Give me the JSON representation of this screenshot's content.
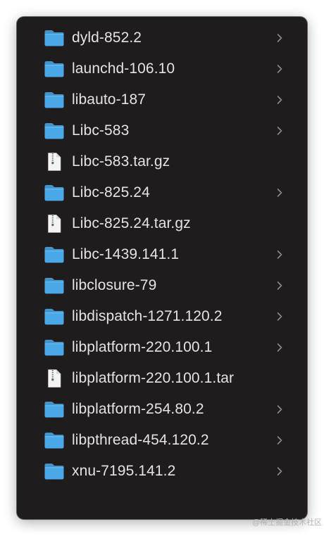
{
  "colors": {
    "window_background": "#201c1d",
    "text": "#e4e2e3",
    "folder_blue": "#4aa8e8",
    "chevron": "#8a8889"
  },
  "files": [
    {
      "name": "dyld-852.2",
      "icon": "folder-icon",
      "expandable": true
    },
    {
      "name": "launchd-106.10",
      "icon": "folder-icon",
      "expandable": true
    },
    {
      "name": "libauto-187",
      "icon": "folder-icon",
      "expandable": true
    },
    {
      "name": "Libc-583",
      "icon": "folder-icon",
      "expandable": true
    },
    {
      "name": "Libc-583.tar.gz",
      "icon": "archive-file-icon",
      "expandable": false
    },
    {
      "name": "Libc-825.24",
      "icon": "folder-icon",
      "expandable": true
    },
    {
      "name": "Libc-825.24.tar.gz",
      "icon": "archive-file-icon",
      "expandable": false
    },
    {
      "name": "Libc-1439.141.1",
      "icon": "folder-icon",
      "expandable": true
    },
    {
      "name": "libclosure-79",
      "icon": "folder-icon",
      "expandable": true
    },
    {
      "name": "libdispatch-1271.120.2",
      "icon": "folder-icon",
      "expandable": true
    },
    {
      "name": "libplatform-220.100.1",
      "icon": "folder-icon",
      "expandable": true
    },
    {
      "name": "libplatform-220.100.1.tar",
      "icon": "archive-file-icon",
      "expandable": false
    },
    {
      "name": "libplatform-254.80.2",
      "icon": "folder-icon",
      "expandable": true
    },
    {
      "name": "libpthread-454.120.2",
      "icon": "folder-icon",
      "expandable": true
    },
    {
      "name": "xnu-7195.141.2",
      "icon": "folder-icon",
      "expandable": true
    }
  ],
  "watermark": "@稀土掘金技术社区"
}
